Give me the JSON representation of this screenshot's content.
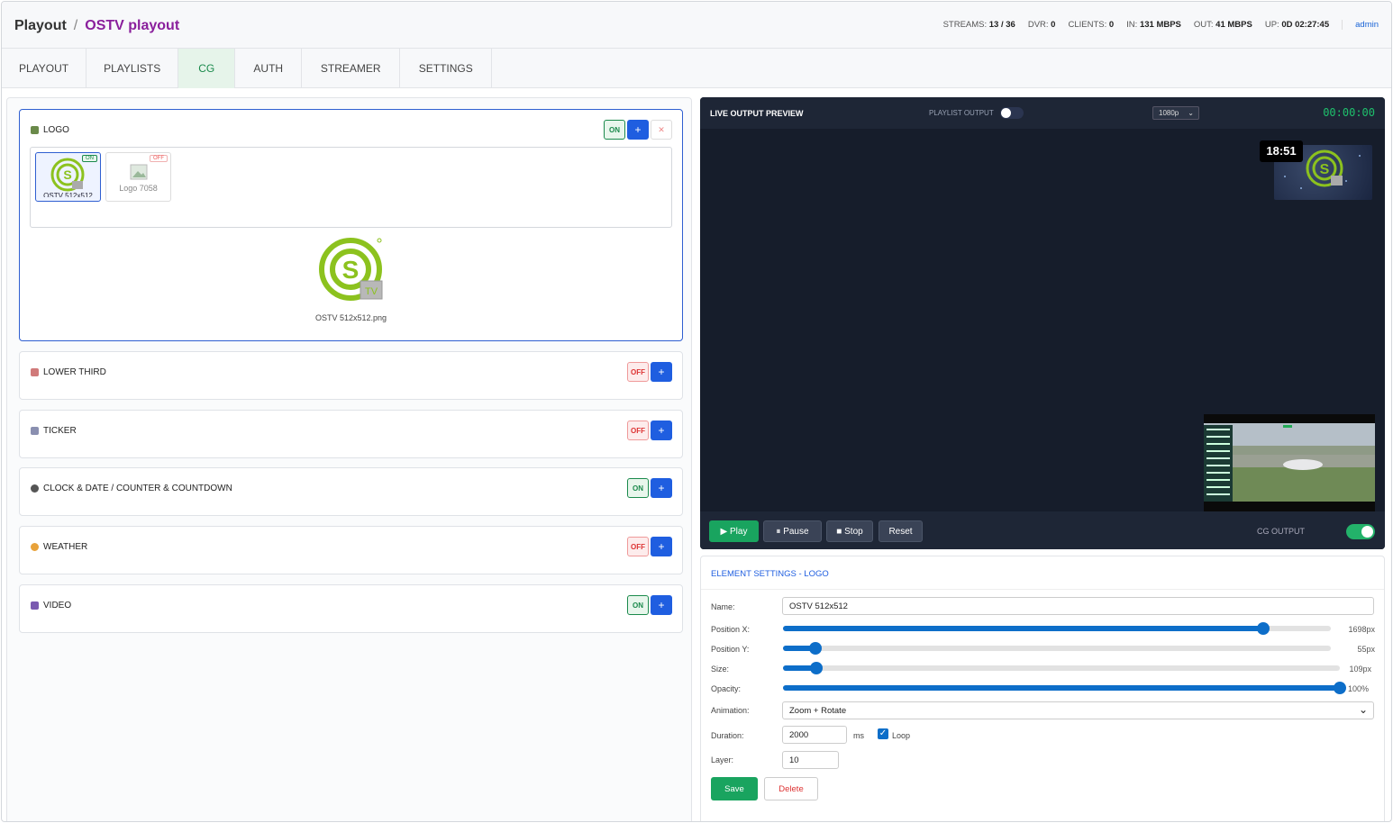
{
  "header": {
    "root": "Playout",
    "current": "OSTV playout"
  },
  "stats": [
    {
      "label": "STREAMS:",
      "value": "13 / 36"
    },
    {
      "label": "DVR:",
      "value": "0"
    },
    {
      "label": "CLIENTS:",
      "value": "0"
    },
    {
      "label": "IN:",
      "value": "131 MBPS"
    },
    {
      "label": "OUT:",
      "value": "41 MBPS"
    },
    {
      "label": "UP:",
      "value": "0D 02:27:45"
    }
  ],
  "user": "admin",
  "tabs": [
    "PLAYOUT",
    "PLAYLISTS",
    "CG",
    "AUTH",
    "STREAMER",
    "SETTINGS"
  ],
  "active_tab": "CG",
  "sections": [
    {
      "title": "LOGO",
      "state": "ON",
      "icon": "image-icon",
      "color": "#6a8a4a"
    },
    {
      "title": "LOWER THIRD",
      "state": "OFF",
      "icon": "lower-third-icon",
      "color": "#d07a7a"
    },
    {
      "title": "TICKER",
      "state": "OFF",
      "icon": "ticker-icon",
      "color": "#8a8fb0"
    },
    {
      "title": "CLOCK & DATE / COUNTER & COUNTDOWN",
      "state": "ON",
      "icon": "clock-icon",
      "color": "#555555"
    },
    {
      "title": "WEATHER",
      "state": "OFF",
      "icon": "weather-icon",
      "color": "#e8a23a"
    },
    {
      "title": "VIDEO",
      "state": "ON",
      "icon": "video-icon",
      "color": "#7a5ab0"
    }
  ],
  "logo": {
    "thumbs": [
      {
        "label": "OSTV 512x512",
        "badge": "ON"
      },
      {
        "label": "Logo 7058",
        "badge": "OFF"
      }
    ],
    "preview_file": "OSTV 512x512.png",
    "logo_text": "TV"
  },
  "add_label": "+",
  "delete_icon_label": "✕",
  "preview": {
    "title": "LIVE OUTPUT PREVIEW",
    "playlist_output": "PLAYLIST OUTPUT",
    "resolution": "1080p",
    "timecode": "00:00:00",
    "clock": "18:51",
    "buttons": [
      "▶ Play",
      "⏸ Pause",
      "■ Stop",
      "Reset"
    ],
    "cg_output": "CG OUTPUT"
  },
  "settings": {
    "title": "ELEMENT SETTINGS - LOGO",
    "name_label": "Name:",
    "name_value": "OSTV 512x512",
    "sliders": [
      {
        "label": "Position X:",
        "value": "1698px",
        "fraction": 0.877
      },
      {
        "label": "Position Y:",
        "value": "55px",
        "fraction": 0.06
      },
      {
        "label": "Size:",
        "value": "109px",
        "fraction": 0.06
      },
      {
        "label": "Opacity:",
        "value": "100%",
        "fraction": 1.0
      }
    ],
    "animation_label": "Animation:",
    "animation_value": "Zoom + Rotate",
    "duration_label": "Duration:",
    "duration_value": "2000",
    "duration_unit": "ms",
    "loop_label": "Loop",
    "layer_label": "Layer:",
    "layer_value": "10",
    "save": "Save",
    "delete": "Delete"
  }
}
